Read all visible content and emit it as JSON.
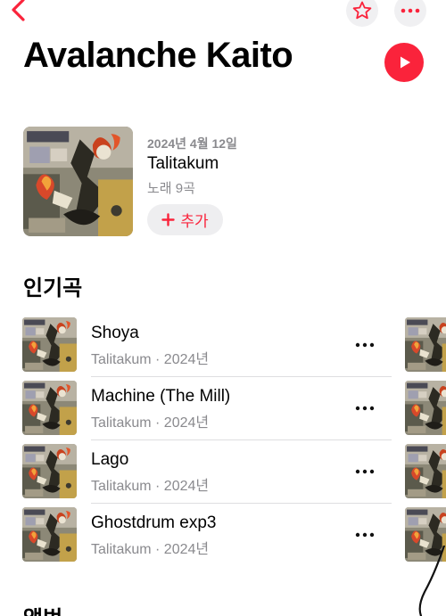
{
  "nav": {
    "back_icon": "chevron-left-icon",
    "favorite_icon": "star-outline-icon",
    "more_icon": "ellipsis-icon"
  },
  "artist": {
    "name": "Avalanche Kaito",
    "play_icon": "play-icon"
  },
  "latest_release": {
    "date": "2024년 4월 12일",
    "title": "Talitakum",
    "track_count": "노래 9곡",
    "add_label": "추가",
    "add_icon": "plus-icon"
  },
  "top_songs": {
    "heading": "인기곡",
    "items": [
      {
        "title": "Shoya",
        "subtitle": "Talitakum · 2024년"
      },
      {
        "title": "Machine (The Mill)",
        "subtitle": "Talitakum · 2024년"
      },
      {
        "title": "Lago",
        "subtitle": "Talitakum · 2024년"
      },
      {
        "title": "Ghostdrum exp3",
        "subtitle": "Talitakum · 2024년"
      }
    ]
  },
  "albums": {
    "heading": "앨범"
  },
  "colors": {
    "accent": "#fa233b",
    "secondary_text": "#8a8a8e",
    "button_bg": "#eeeef0"
  }
}
